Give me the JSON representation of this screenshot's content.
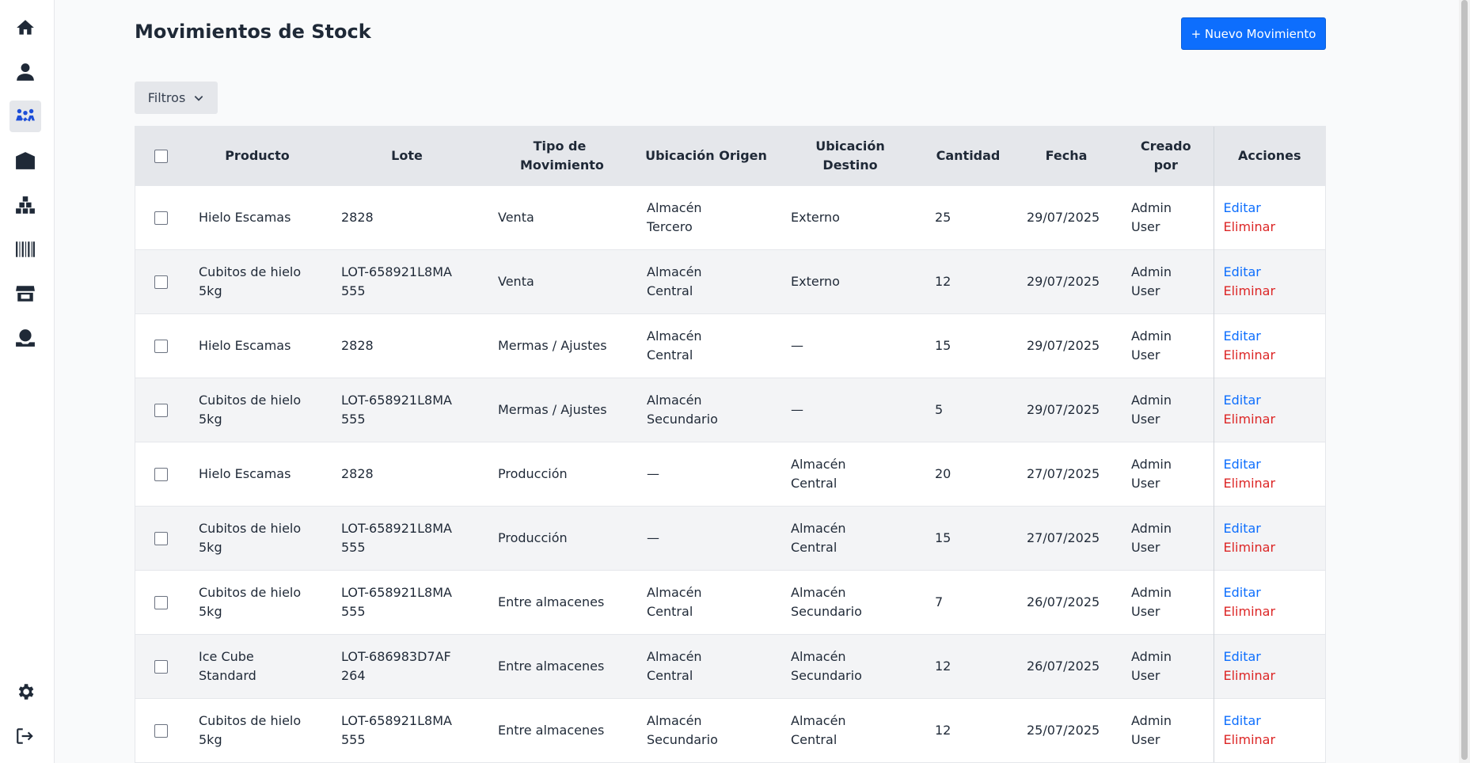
{
  "page": {
    "title": "Movimientos de Stock",
    "new_button_label": "+ Nuevo Movimiento",
    "filters_label": "Filtros"
  },
  "sidebar": {
    "items": [
      {
        "icon": "home-icon",
        "active": false
      },
      {
        "icon": "user-icon",
        "active": false
      },
      {
        "icon": "users-icon",
        "active": true
      },
      {
        "icon": "warehouse-icon",
        "active": false
      },
      {
        "icon": "boxes-icon",
        "active": false
      },
      {
        "icon": "barcode-icon",
        "active": false
      },
      {
        "icon": "store-icon",
        "active": false
      },
      {
        "icon": "money-icon",
        "active": false
      }
    ],
    "bottom": [
      {
        "icon": "gear-icon"
      },
      {
        "icon": "logout-icon"
      }
    ]
  },
  "table": {
    "headers": {
      "producto": "Producto",
      "lote": "Lote",
      "tipo": "Tipo de Movimiento",
      "origen": "Ubicación Origen",
      "destino": "Ubicación Destino",
      "cantidad": "Cantidad",
      "fecha": "Fecha",
      "creado": "Creado por",
      "acciones": "Acciones"
    },
    "edit_label": "Editar",
    "delete_label": "Eliminar",
    "rows": [
      {
        "producto": "Hielo Escamas",
        "lote": "2828",
        "tipo": "Venta",
        "origen": "Almacén Tercero",
        "destino": "Externo",
        "cantidad": "25",
        "fecha": "29/07/2025",
        "creado": "Admin User"
      },
      {
        "producto": "Cubitos de hielo 5kg",
        "lote": "LOT-658921L8MA555",
        "tipo": "Venta",
        "origen": "Almacén Central",
        "destino": "Externo",
        "cantidad": "12",
        "fecha": "29/07/2025",
        "creado": "Admin User"
      },
      {
        "producto": "Hielo Escamas",
        "lote": "2828",
        "tipo": "Mermas / Ajustes",
        "origen": "Almacén Central",
        "destino": "—",
        "cantidad": "15",
        "fecha": "29/07/2025",
        "creado": "Admin User"
      },
      {
        "producto": "Cubitos de hielo 5kg",
        "lote": "LOT-658921L8MA555",
        "tipo": "Mermas / Ajustes",
        "origen": "Almacén Secundario",
        "destino": "—",
        "cantidad": "5",
        "fecha": "29/07/2025",
        "creado": "Admin User"
      },
      {
        "producto": "Hielo Escamas",
        "lote": "2828",
        "tipo": "Producción",
        "origen": "—",
        "destino": "Almacén Central",
        "cantidad": "20",
        "fecha": "27/07/2025",
        "creado": "Admin User"
      },
      {
        "producto": "Cubitos de hielo 5kg",
        "lote": "LOT-658921L8MA555",
        "tipo": "Producción",
        "origen": "—",
        "destino": "Almacén Central",
        "cantidad": "15",
        "fecha": "27/07/2025",
        "creado": "Admin User"
      },
      {
        "producto": "Cubitos de hielo 5kg",
        "lote": "LOT-658921L8MA555",
        "tipo": "Entre almacenes",
        "origen": "Almacén Central",
        "destino": "Almacén Secundario",
        "cantidad": "7",
        "fecha": "26/07/2025",
        "creado": "Admin User"
      },
      {
        "producto": "Ice Cube Standard",
        "lote": "LOT-686983D7AF264",
        "tipo": "Entre almacenes",
        "origen": "Almacén Central",
        "destino": "Almacén Secundario",
        "cantidad": "12",
        "fecha": "26/07/2025",
        "creado": "Admin User"
      },
      {
        "producto": "Cubitos de hielo 5kg",
        "lote": "LOT-658921L8MA555",
        "tipo": "Entre almacenes",
        "origen": "Almacén Secundario",
        "destino": "Almacén Central",
        "cantidad": "12",
        "fecha": "25/07/2025",
        "creado": "Admin User"
      }
    ]
  }
}
